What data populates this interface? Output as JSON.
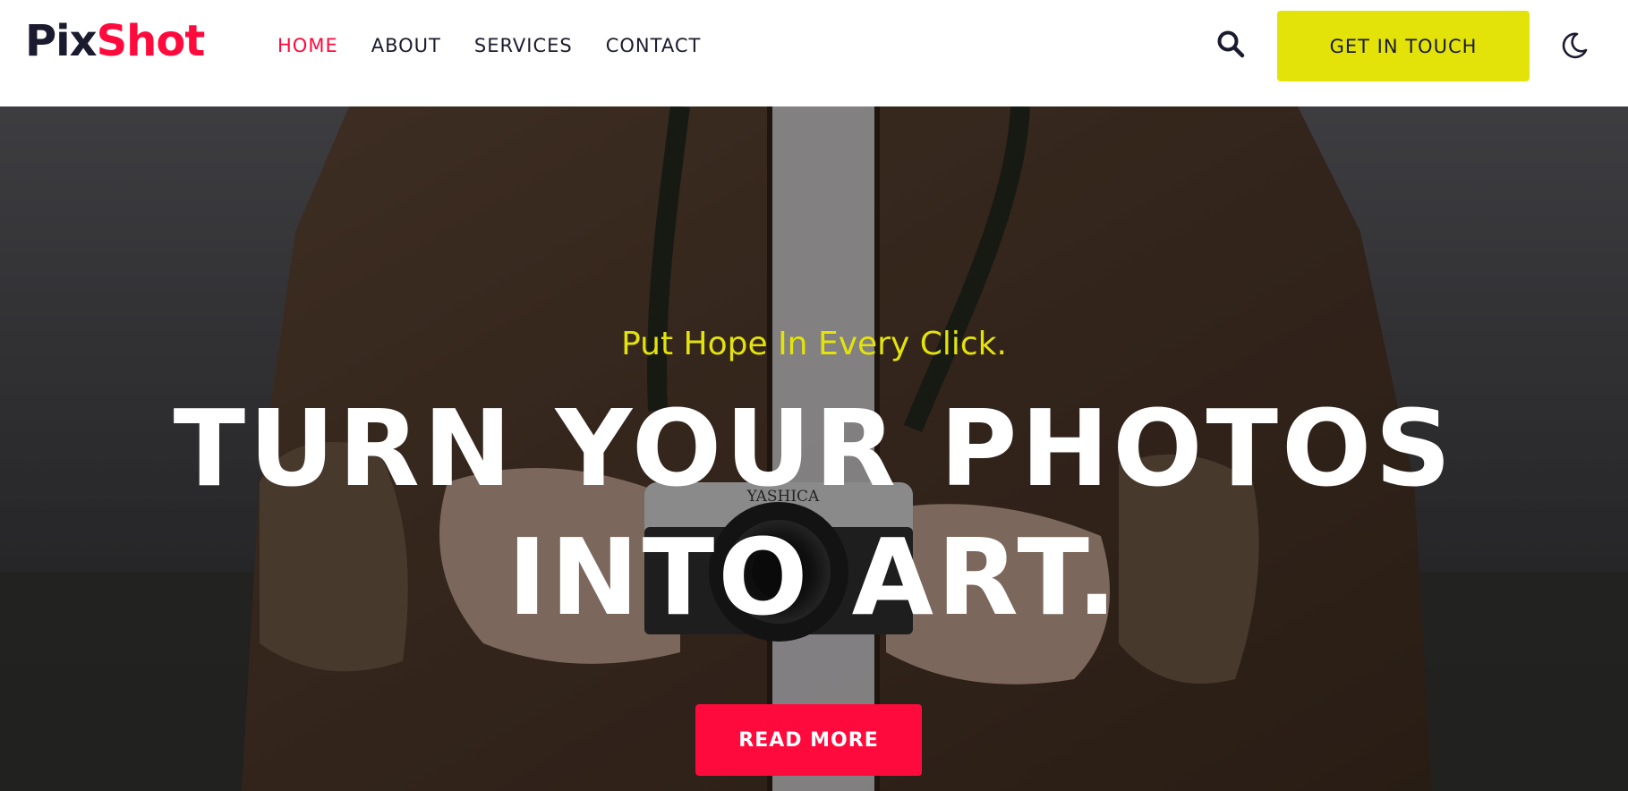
{
  "brand": {
    "logo_part1": "Pix",
    "logo_part2": "Shot",
    "accent_color": "#ff0a3c",
    "highlight_color": "#e3e30a",
    "dark_color": "#1b1b2f"
  },
  "nav": {
    "items": [
      {
        "label": "HOME",
        "active": true
      },
      {
        "label": "ABOUT",
        "active": false
      },
      {
        "label": "SERVICES",
        "active": false
      },
      {
        "label": "CONTACT",
        "active": false
      }
    ]
  },
  "header_actions": {
    "search_icon": "search-icon",
    "cta_label": "GET IN TOUCH",
    "theme_icon": "moon-icon"
  },
  "hero": {
    "tagline": "Put Hope In Every Click.",
    "headline_line1": "TURN YOUR PHOTOS",
    "headline_line2": "INTO ART.",
    "button_label": "READ MORE",
    "camera_brand": "YASHICA"
  }
}
